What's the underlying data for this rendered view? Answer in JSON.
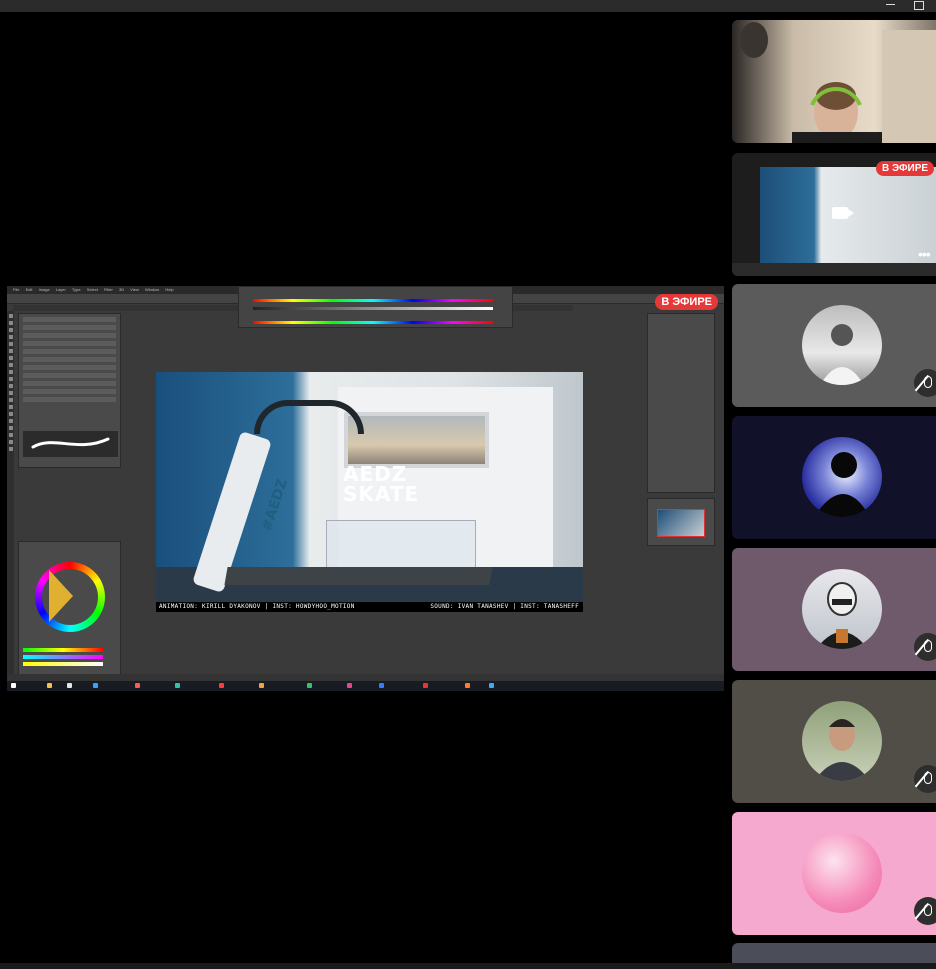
{
  "window": {
    "controls": [
      "minimize",
      "maximize"
    ]
  },
  "main_stream": {
    "live_badge": "В ЭФИРЕ",
    "app": "photoshop",
    "menu": [
      "File",
      "Edit",
      "Image",
      "Layer",
      "Type",
      "Select",
      "Filter",
      "3D",
      "View",
      "Window",
      "Help"
    ],
    "artwork": {
      "brand_line1": "AEDZ",
      "brand_line2": "SKATE",
      "tread_text": "#AEDZ",
      "credit_left": "ANIMATION: KIRILL DYAKONOV  |  INST: HOWDYHOO_MOTION",
      "credit_right": "SOUND: IVAN TANASHEV  |  INST: TANASHEFF"
    }
  },
  "participants": [
    {
      "id": "p1",
      "kind": "video",
      "icon": "webcam-video"
    },
    {
      "id": "p2",
      "kind": "screen-thumbnail",
      "badge": "В ЭФИРЕ",
      "icons": [
        "camera-icon",
        "more-icon"
      ]
    },
    {
      "id": "p3",
      "kind": "avatar",
      "muted": true,
      "bg": "#5b5b5b"
    },
    {
      "id": "p4",
      "kind": "avatar",
      "muted": false,
      "bg": "#11112a"
    },
    {
      "id": "p5",
      "kind": "avatar",
      "muted": true,
      "bg": "#6e5a6a"
    },
    {
      "id": "p6",
      "kind": "avatar",
      "muted": true,
      "bg": "#514e48"
    },
    {
      "id": "p7",
      "kind": "avatar",
      "muted": true,
      "bg": "#f6a9cf"
    },
    {
      "id": "p8",
      "kind": "partial",
      "bg": "#4b4e58"
    }
  ],
  "colors": {
    "live_red": "#e53939",
    "tile_radius_bg": "#000000"
  }
}
